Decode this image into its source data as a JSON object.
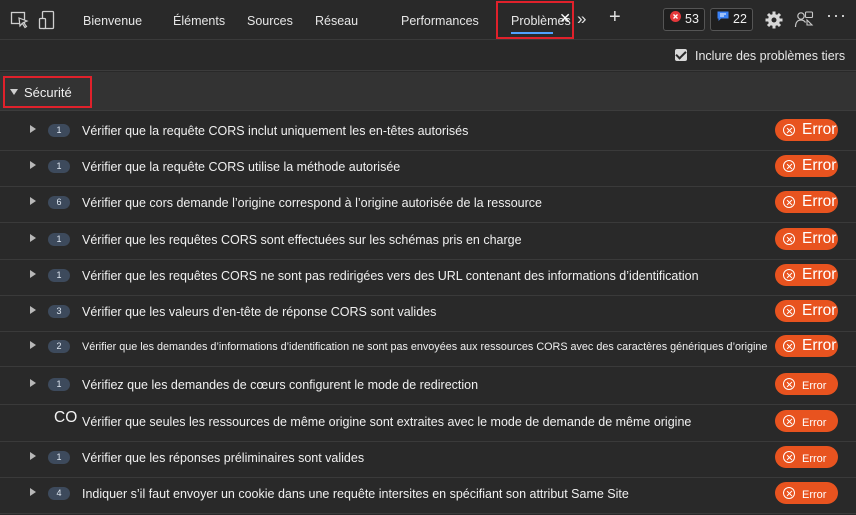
{
  "toolbar": {
    "tabs": [
      "Bienvenue",
      "Éléments",
      "Sources",
      "Réseau",
      "Performances",
      "Problèmes"
    ],
    "error_count": "53",
    "message_count": "22"
  },
  "subbar": {
    "checkbox_label": "Inclure des problèmes tiers",
    "checked": true
  },
  "section": {
    "title": "Sécurité"
  },
  "issues": [
    {
      "count": "1",
      "title": "Vérifier que la requête CORS inclut uniquement les en-têtes autorisés",
      "severity": "Error"
    },
    {
      "count": "1",
      "title": "Vérifier que la requête CORS utilise la méthode autorisée",
      "severity": "Error"
    },
    {
      "count": "6",
      "title": "Vérifier que cors demande l’origine correspond à l’origine autorisée de la ressource",
      "severity": "Error"
    },
    {
      "count": "1",
      "title": "Vérifier que les requêtes CORS sont effectuées sur les schémas pris en charge",
      "severity": "Error"
    },
    {
      "count": "1",
      "title": "Vérifier que les requêtes CORS ne sont pas redirigées vers des URL contenant des informations d’identification",
      "severity": "Error"
    },
    {
      "count": "3",
      "title": "Vérifier que les valeurs d’en-tête de réponse CORS sont valides",
      "severity": "Error"
    },
    {
      "count": "2",
      "title": "Vérifier que les demandes d’informations d’identification ne sont pas envoyées aux ressources CORS avec des caractères génériques d’origine",
      "severity": "Error"
    },
    {
      "count": "1",
      "title": "Vérifiez que les demandes de cœurs configurent le mode de redirection",
      "severity": "Error"
    },
    {
      "prefix": "CO",
      "title": "Vérifier que seules les ressources de même origine sont extraites avec le mode de demande de même origine",
      "severity": "Error"
    },
    {
      "count": "1",
      "title": "Vérifier que les réponses préliminaires sont valides",
      "severity": "Error"
    },
    {
      "count": "4",
      "title": "Indiquer s’il faut envoyer un cookie dans une requête intersites en spécifiant son attribut Same Site",
      "severity": "Error"
    }
  ],
  "colors": {
    "background": "#292929",
    "error_pill": "#e8531f",
    "highlight_box": "#e0212b",
    "active_tab_underline": "#4ea1ff"
  },
  "icons": [
    "inspect-icon",
    "device-emulation-icon",
    "more-tabs-icon",
    "add-tab-icon",
    "error-icon",
    "message-icon",
    "settings-icon",
    "feedback-icon",
    "more-options-icon"
  ]
}
